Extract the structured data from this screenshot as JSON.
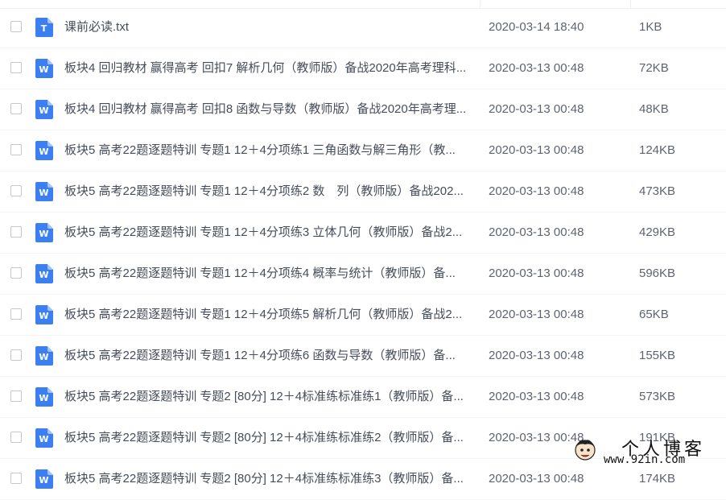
{
  "files": [
    {
      "type": "txt",
      "icon": "text-file-icon",
      "icon_letter": "T",
      "name": "课前必读.txt",
      "date": "2020-03-14 18:40",
      "size": "1KB"
    },
    {
      "type": "doc",
      "icon": "word-file-icon",
      "icon_letter": "W",
      "name": "板块4 回归教材 赢得高考 回扣7 解析几何（教师版）备战2020年高考理科...",
      "date": "2020-03-13 00:48",
      "size": "72KB"
    },
    {
      "type": "doc",
      "icon": "word-file-icon",
      "icon_letter": "W",
      "name": "板块4 回归教材 赢得高考 回扣8 函数与导数（教师版）备战2020年高考理...",
      "date": "2020-03-13 00:48",
      "size": "48KB"
    },
    {
      "type": "doc",
      "icon": "word-file-icon",
      "icon_letter": "W",
      "name": "板块5 高考22题逐题特训 专题1 12＋4分项练1 三角函数与解三角形（教...",
      "date": "2020-03-13 00:48",
      "size": "124KB"
    },
    {
      "type": "doc",
      "icon": "word-file-icon",
      "icon_letter": "W",
      "name": "板块5 高考22题逐题特训 专题1 12＋4分项练2 数　列（教师版）备战202...",
      "date": "2020-03-13 00:48",
      "size": "473KB"
    },
    {
      "type": "doc",
      "icon": "word-file-icon",
      "icon_letter": "W",
      "name": "板块5 高考22题逐题特训 专题1 12＋4分项练3 立体几何（教师版）备战2...",
      "date": "2020-03-13 00:48",
      "size": "429KB"
    },
    {
      "type": "doc",
      "icon": "word-file-icon",
      "icon_letter": "W",
      "name": "板块5 高考22题逐题特训 专题1 12＋4分项练4 概率与统计（教师版）备...",
      "date": "2020-03-13 00:48",
      "size": "596KB"
    },
    {
      "type": "doc",
      "icon": "word-file-icon",
      "icon_letter": "W",
      "name": "板块5 高考22题逐题特训 专题1 12＋4分项练5 解析几何（教师版）备战2...",
      "date": "2020-03-13 00:48",
      "size": "65KB"
    },
    {
      "type": "doc",
      "icon": "word-file-icon",
      "icon_letter": "W",
      "name": "板块5 高考22题逐题特训 专题1 12＋4分项练6 函数与导数（教师版）备...",
      "date": "2020-03-13 00:48",
      "size": "155KB"
    },
    {
      "type": "doc",
      "icon": "word-file-icon",
      "icon_letter": "W",
      "name": "板块5 高考22题逐题特训 专题2 [80分] 12＋4标准练标准练1（教师版）备...",
      "date": "2020-03-13 00:48",
      "size": "573KB"
    },
    {
      "type": "doc",
      "icon": "word-file-icon",
      "icon_letter": "W",
      "name": "板块5 高考22题逐题特训 专题2 [80分] 12＋4标准练标准练2（教师版）备...",
      "date": "2020-03-13 00:48",
      "size": "191KB"
    },
    {
      "type": "doc",
      "icon": "word-file-icon",
      "icon_letter": "W",
      "name": "板块5 高考22题逐题特训 专题2 [80分] 12＋4标准练标准练3（教师版）备...",
      "date": "2020-03-13 00:48",
      "size": "174KB"
    }
  ],
  "watermark": {
    "title": "个人博客",
    "url": "www.92in.com",
    "icon": "cartoon-face-logo"
  },
  "colors": {
    "icon_blue": "#3b7ff1",
    "text": "#454d5a",
    "meta": "#5d6470"
  }
}
